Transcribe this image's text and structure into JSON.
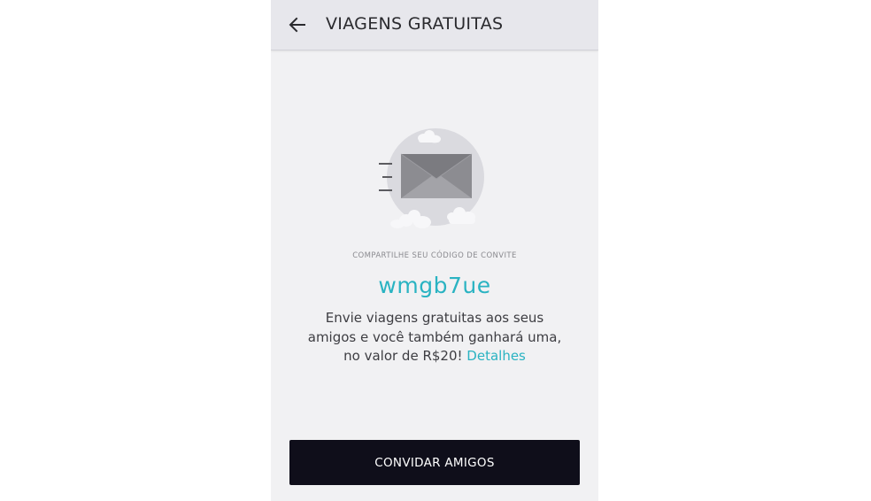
{
  "header": {
    "title": "VIAGENS GRATUITAS",
    "back_icon": "arrow-left-icon"
  },
  "illustration": {
    "icon": "envelope-icon"
  },
  "invite": {
    "label": "COMPARTILHE SEU CÓDIGO DE CONVITE",
    "code": "wmgb7ue",
    "description_line1": "Envie viagens gratuitas aos seus",
    "description_line2": "amigos e você também ganhará uma,",
    "description_line3": "no valor de R$20!",
    "details_link": "Detalhes"
  },
  "button": {
    "label": "CONVIDAR AMIGOS"
  },
  "colors": {
    "accent": "#2ab3c2",
    "button_bg": "#0f0e1a",
    "background": "#f1f1f3",
    "header_bg": "#e7e7ec"
  }
}
